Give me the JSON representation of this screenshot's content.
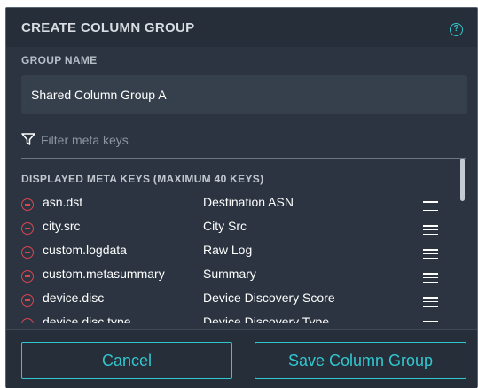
{
  "dialog": {
    "title": "CREATE COLUMN GROUP",
    "help_icon_glyph": "?",
    "group_name_label": "GROUP NAME",
    "group_name_value": "Shared Column Group A",
    "filter_placeholder": "Filter meta keys",
    "keys_heading": "DISPLAYED META KEYS (MAXIMUM 40 KEYS)",
    "rows": [
      {
        "key": "asn.dst",
        "display": "Destination ASN"
      },
      {
        "key": "city.src",
        "display": "City Src"
      },
      {
        "key": "custom.logdata",
        "display": "Raw Log"
      },
      {
        "key": "custom.metasummary",
        "display": "Summary"
      },
      {
        "key": "device.disc",
        "display": "Device Discovery Score"
      },
      {
        "key": "device.disc.type",
        "display": "Device Discovery Type"
      }
    ],
    "cancel_label": "Cancel",
    "save_label": "Save Column Group"
  },
  "icons": {
    "help": "help-circle-icon",
    "filter": "funnel-icon",
    "remove": "minus-circle-icon",
    "drag": "drag-handle-icon"
  },
  "colors": {
    "accent": "#31c7cf",
    "remove": "#d9474f",
    "dialog_bg": "#2b3440",
    "header_bg": "#262e39",
    "input_bg": "#36404c"
  }
}
